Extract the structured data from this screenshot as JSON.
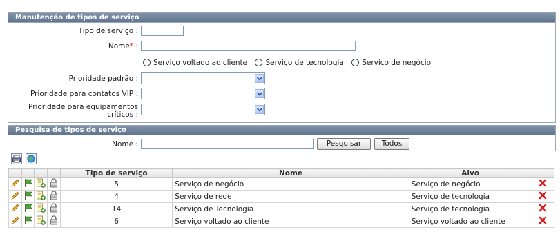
{
  "form": {
    "title": "Manutenção de tipos de serviço",
    "tipo_label": "Tipo de serviço :",
    "nome_label": "Nome",
    "nome_required": "*",
    "nome_colon": " :",
    "radios": [
      "Serviço voltado ao cliente",
      "Serviço de tecnologia",
      "Serviço de negócio"
    ],
    "prioridade_padrao_label": "Prioridade padrão :",
    "prioridade_vip_label": "Prioridade para contatos VIP :",
    "prioridade_equip_label_1": "Prioridade para equipamentos",
    "prioridade_equip_label_2": "críticos :"
  },
  "search": {
    "title": "Pesquisa de tipos de serviço",
    "nome_label": "Nome :",
    "search_button": "Pesquisar",
    "all_button": "Todos"
  },
  "table": {
    "headers": [
      "Tipo de serviço",
      "Nome",
      "Alvo"
    ],
    "rows": [
      {
        "tipo": "5",
        "nome": "Serviço de negócio",
        "alvo": "Serviço de negócio"
      },
      {
        "tipo": "4",
        "nome": "Serviço de rede",
        "alvo": "Serviço de tecnologia"
      },
      {
        "tipo": "14",
        "nome": "Serviço de Tecnologia",
        "alvo": "Serviço de tecnologia"
      },
      {
        "tipo": "6",
        "nome": "Serviço voltado ao cliente",
        "alvo": "Serviço voltado ao cliente"
      }
    ]
  },
  "colors": {
    "header_bg": "#6a7f98",
    "required": "#e02020",
    "delete": "#d81c1c"
  }
}
